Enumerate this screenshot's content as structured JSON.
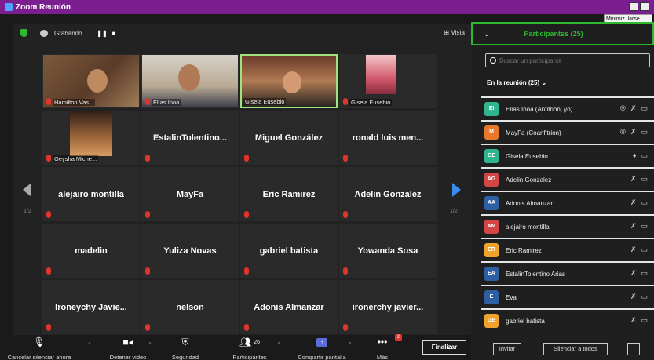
{
  "window": {
    "title": "Zoom Reunión",
    "tooltip": "Minimiz. larse"
  },
  "topbar": {
    "recording_label": "Grabando...",
    "pause_icon": "pause-icon",
    "stop_icon": "stop-icon",
    "view_label": "Vista"
  },
  "video_tiles": [
    {
      "label": "Hamilton Vas...",
      "video": true
    },
    {
      "label": "Elías Inoa",
      "video": true
    },
    {
      "label": "Gisela Eusebio",
      "video": true,
      "active": true
    },
    {
      "label": "Gisela Eusebio",
      "video": true
    },
    {
      "label": "Geysha Miche...",
      "video": true
    },
    {
      "label": "EstalinTolentino...",
      "video": false
    },
    {
      "label": "Miguel González",
      "video": false
    },
    {
      "label": "ronald luis men...",
      "video": false
    },
    {
      "label": "alejairo montilla",
      "video": false
    },
    {
      "label": "MayFa",
      "video": false
    },
    {
      "label": "Eric Ramirez",
      "video": false
    },
    {
      "label": "Adelin Gonzalez",
      "video": false
    },
    {
      "label": "madelin",
      "video": false
    },
    {
      "label": "Yuliza Novas",
      "video": false
    },
    {
      "label": "gabriel batista",
      "video": false
    },
    {
      "label": "Yowanda Sosa",
      "video": false
    },
    {
      "label": "Ironeychy Javie...",
      "video": false
    },
    {
      "label": "nelson",
      "video": false
    },
    {
      "label": "Adonis Almanzar",
      "video": false
    },
    {
      "label": "ironerchy javier...",
      "video": false
    }
  ],
  "pagination": {
    "left": "1/2",
    "right": "1/2"
  },
  "toolbar": {
    "mute_label": "Cancelar silenciar ahora",
    "video_label": "Detener video",
    "security_label": "Seguridad",
    "participants_label": "Participantes",
    "participants_count": "26",
    "share_label": "Compartir pantalla",
    "more_label": "Más",
    "more_badge": "2",
    "end_label": "Finalizar"
  },
  "panel": {
    "title": "Participantes (25)",
    "search_placeholder": "Buscar un participante",
    "in_meeting": "En la reunión (25)",
    "participants": [
      {
        "initials": "EI",
        "name": "Elías Inoa (Anfitrión, yo)",
        "color": "#2fb58f"
      },
      {
        "initials": "M",
        "name": "MayFa (Coanfitrión)",
        "color": "#e8782a"
      },
      {
        "initials": "GE",
        "name": "Gisela Eusebio",
        "color": "#2fb58f"
      },
      {
        "initials": "AG",
        "name": "Adelin Gonzalez",
        "color": "#d64545"
      },
      {
        "initials": "AA",
        "name": "Adonis Almanzar",
        "color": "#2f5fa3"
      },
      {
        "initials": "AM",
        "name": "alejairo montilla",
        "color": "#d64545"
      },
      {
        "initials": "ER",
        "name": "Eric Ramirez",
        "color": "#f0a22b"
      },
      {
        "initials": "EA",
        "name": "EstalinTolentino Arias",
        "color": "#2f5fa3"
      },
      {
        "initials": "E",
        "name": "Eva",
        "color": "#2f5fa3"
      },
      {
        "initials": "GB",
        "name": "gabriel batista",
        "color": "#f0a22b"
      }
    ],
    "invite_label": "Invitar",
    "mute_all_label": "Silenciar a todos"
  }
}
